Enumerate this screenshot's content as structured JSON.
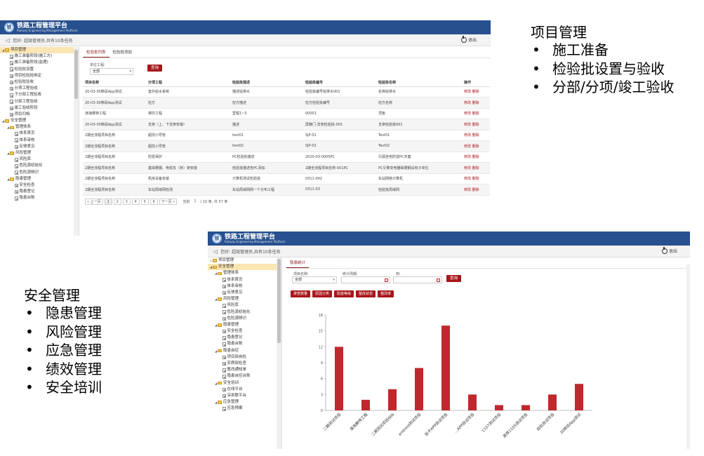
{
  "app": {
    "title": "铁路工程管理平台",
    "subtitle": "Railway Engineering Management Platform",
    "greeting": "您好:  超级管理员,共有10条任务",
    "logout": "退出"
  },
  "shot1": {
    "tree": [
      {
        "label": "项目管理",
        "level": 0,
        "type": "folder",
        "state": "open",
        "selected": true
      },
      {
        "label": "施工准备阶段(施工方)",
        "level": 1,
        "type": "doc"
      },
      {
        "label": "施工准备阶段(监理)",
        "level": 1,
        "type": "doc"
      },
      {
        "label": "检验批设置",
        "level": 1,
        "type": "doc"
      },
      {
        "label": "项目检验批绑定",
        "level": 1,
        "type": "doc"
      },
      {
        "label": "检验批验收",
        "level": 1,
        "type": "doc"
      },
      {
        "label": "分项工程验收",
        "level": 1,
        "type": "doc"
      },
      {
        "label": "子分部工程验收",
        "level": 1,
        "type": "doc"
      },
      {
        "label": "分部工程验收",
        "level": 1,
        "type": "doc"
      },
      {
        "label": "竣工验收阶段",
        "level": 1,
        "type": "doc"
      },
      {
        "label": "项目归档",
        "level": 1,
        "type": "doc"
      },
      {
        "label": "安全管理",
        "level": 0,
        "type": "folder",
        "state": "open"
      },
      {
        "label": "管理体系",
        "level": 1,
        "type": "folder",
        "state": "open"
      },
      {
        "label": "体系首页",
        "level": 2,
        "type": "doc"
      },
      {
        "label": "体系审核",
        "level": 2,
        "type": "doc"
      },
      {
        "label": "反馈意见",
        "level": 2,
        "type": "doc"
      },
      {
        "label": "风险管理",
        "level": 1,
        "type": "folder",
        "state": "open"
      },
      {
        "label": "风险库",
        "level": 2,
        "type": "doc"
      },
      {
        "label": "危险源初始化",
        "level": 2,
        "type": "doc"
      },
      {
        "label": "危险源辨识",
        "level": 2,
        "type": "doc"
      },
      {
        "label": "隐患管理",
        "level": 1,
        "type": "folder",
        "state": "open"
      },
      {
        "label": "安全检查",
        "level": 2,
        "type": "doc"
      },
      {
        "label": "隐患登记",
        "level": 2,
        "type": "doc"
      },
      {
        "label": "隐患台账",
        "level": 2,
        "type": "doc"
      }
    ],
    "tabs": [
      "检验批列表",
      "检验批添加"
    ],
    "filter": {
      "label": "单位工程:",
      "value": "全部",
      "query": "查询"
    },
    "columns": [
      "项目名称",
      "分项工程",
      "检验批描述",
      "检验批编号",
      "检验批名称",
      "操作"
    ],
    "rows": [
      [
        "20-03-30移段App测试",
        "室外给水系统",
        "描述给排水",
        "检验批编号给排水001",
        "名称给排水",
        "修改 删除"
      ],
      [
        "20-03-30移段App测试",
        "挖方",
        "挖方描述",
        "挖方检验批编号",
        "挖方名称",
        "修改 删除"
      ],
      [
        "演海赛特工程",
        "梯坎工程",
        "里程1~3",
        "00001",
        "顶板",
        "修改 删除"
      ],
      [
        "20-03-30移段App测试",
        "支架（上、下支架安装）",
        "描述",
        "屏蔽门-支架检验批-001",
        "支架检验批001",
        "修改 删除"
      ],
      [
        "2期全流程项目名称",
        "超前小导管",
        "test01",
        "SJP-01",
        "Test01",
        "修改 删除"
      ],
      [
        "2期全流程项目名称",
        "超前小导管",
        "test02",
        "SJP-02",
        "Test02",
        "修改 删除"
      ],
      [
        "2期全流程项目名称",
        "防雷保护",
        "PC检验批描述",
        "2020-03-0005PC",
        "引弧坐电防雷PC天健",
        "修改 删除"
      ],
      [
        "2期全流程项目名称",
        "基础槽钢、电缆支（桥）架安装",
        "检验批描述告PC添加",
        "2期全流程项目名称-001PC",
        "PC引擎变电器础槽钢设有子单位",
        "修改 删除"
      ],
      [
        "2期全流程项目名称",
        "机房设备安装",
        "计算机测试检验批",
        "0311-002",
        "车站网络计算机",
        "修改 删除"
      ],
      [
        "2期全流程项目名称",
        "车站局域网检测",
        "车站局域网网一个分布工程",
        "0311-03",
        "检验批局域网",
        "修改 删除"
      ]
    ],
    "pager": {
      "prev": "« 上一页",
      "pages": [
        "1",
        "2",
        "3",
        "4",
        "5",
        "6"
      ],
      "next": "下一页 »",
      "goto": "当前",
      "current": "1",
      "info": "/ 10  条, 共 57 条"
    }
  },
  "shot2": {
    "tree": [
      {
        "label": "项目管理",
        "level": 0,
        "type": "folder",
        "state": "closed"
      },
      {
        "label": "安全管理",
        "level": 0,
        "type": "folder",
        "state": "open",
        "selected": true
      },
      {
        "label": "管理体系",
        "level": 1,
        "type": "folder",
        "state": "open"
      },
      {
        "label": "体系首页",
        "level": 2,
        "type": "doc"
      },
      {
        "label": "体系审核",
        "level": 2,
        "type": "doc"
      },
      {
        "label": "反馈意见",
        "level": 2,
        "type": "doc"
      },
      {
        "label": "风险管理",
        "level": 1,
        "type": "folder",
        "state": "open"
      },
      {
        "label": "风险库",
        "level": 2,
        "type": "doc"
      },
      {
        "label": "危险源初始化",
        "level": 2,
        "type": "doc"
      },
      {
        "label": "危险源辨识",
        "level": 2,
        "type": "doc"
      },
      {
        "label": "隐患管理",
        "level": 1,
        "type": "folder",
        "state": "open"
      },
      {
        "label": "安全检查",
        "level": 2,
        "type": "doc"
      },
      {
        "label": "隐患登记",
        "level": 2,
        "type": "doc"
      },
      {
        "label": "隐患台账",
        "level": 2,
        "type": "doc"
      },
      {
        "label": "隐患自控",
        "level": 1,
        "type": "folder",
        "state": "open"
      },
      {
        "label": "项目部自检",
        "level": 2,
        "type": "doc"
      },
      {
        "label": "安质部检查",
        "level": 2,
        "type": "doc"
      },
      {
        "label": "整改通知单",
        "level": 2,
        "type": "doc"
      },
      {
        "label": "隐患自控台账",
        "level": 2,
        "type": "doc"
      },
      {
        "label": "安全培训",
        "level": 1,
        "type": "folder",
        "state": "open"
      },
      {
        "label": "在线平台",
        "level": 2,
        "type": "doc"
      },
      {
        "label": "深圳联平台",
        "level": 2,
        "type": "doc"
      },
      {
        "label": "应急管理",
        "level": 1,
        "type": "folder",
        "state": "open"
      },
      {
        "label": "应急预案",
        "level": 2,
        "type": "doc"
      }
    ],
    "tabs": [
      "隐患统计"
    ],
    "filter": {
      "project_label": "项目名称:",
      "project_value": "全部",
      "period_label": "统计周期:",
      "to_label": "到:",
      "query": "查询"
    },
    "stat_buttons": [
      "排查数量",
      "原因分类",
      "隐患等级",
      "整改状态",
      "整改率"
    ]
  },
  "chart_data": {
    "type": "bar",
    "categories": [
      "二期测试项目",
      "演海赛特工程",
      "二期测试项目666",
      "android测试项目",
      "鼠子APP测试项目",
      "...APP测试项目",
      "1107测试项目",
      "高铁1105测试项目",
      "自检测试项目",
      "30移段App测试"
    ],
    "values": [
      12,
      2,
      4,
      8,
      16,
      3,
      1,
      1,
      3,
      5
    ],
    "ylim": [
      0,
      18
    ],
    "yticks": [
      "0",
      "3",
      "6",
      "9",
      "12",
      "15",
      "18"
    ],
    "color": "#c0282d",
    "grid": false
  },
  "outline_project": {
    "title": "项目管理",
    "items": [
      "施工准备",
      "检验批设置与验收",
      "分部/分项/竣工验收"
    ]
  },
  "outline_safety": {
    "title": "安全管理",
    "items": [
      "隐患管理",
      "风险管理",
      "应急管理",
      "绩效管理",
      "安全培训"
    ]
  }
}
